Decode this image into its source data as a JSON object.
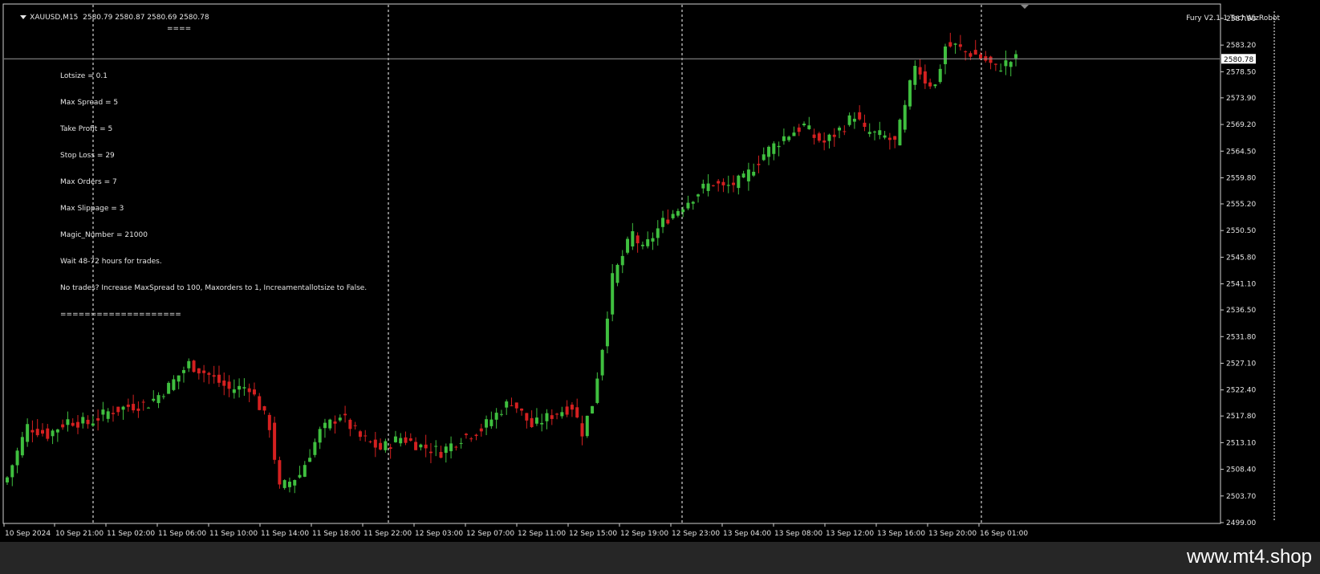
{
  "header": {
    "symbol": "XAUUSD,M15",
    "quote": "2580.79 2580.87 2580.69 2580.78"
  },
  "ea_label": "Fury V2.1-1 TechWizRobot",
  "info_panel": {
    "top_separator": "====",
    "lines": [
      "Lotsize = 0.1",
      "Max Spread = 5",
      "Take Profit = 5",
      "Stop Loss = 29",
      "Max Orders = 7",
      "Max Slippage = 3",
      "Magic_Number = 21000",
      "Wait 48-72 hours for trades.",
      "No trades? Increase MaxSpread to 100, Maxorders to 1, Increamentallotsize to False.",
      "===================="
    ]
  },
  "watermark": "www.mt4.shop",
  "colors": {
    "background": "#000000",
    "bull_candle": "#3fbf3f",
    "bear_candle": "#d42020",
    "grid_line": "#ffffff",
    "text": "#e6e6e6",
    "price_tag_bg": "#ffffff"
  },
  "chart_data": {
    "type": "candlestick",
    "symbol": "XAUUSD",
    "timeframe": "M15",
    "y_ticks": [
      2587.9,
      2583.2,
      2578.5,
      2573.9,
      2569.2,
      2564.5,
      2559.8,
      2555.2,
      2550.5,
      2545.8,
      2541.1,
      2536.5,
      2531.8,
      2527.1,
      2522.4,
      2517.8,
      2513.1,
      2508.4,
      2503.7,
      2499.0
    ],
    "ylim": [
      2499.0,
      2590.3
    ],
    "x_ticks": [
      "10 Sep 2024",
      "10 Sep 21:00",
      "11 Sep 02:00",
      "11 Sep 06:00",
      "11 Sep 10:00",
      "11 Sep 14:00",
      "11 Sep 18:00",
      "11 Sep 22:00",
      "12 Sep 03:00",
      "12 Sep 07:00",
      "12 Sep 11:00",
      "12 Sep 15:00",
      "12 Sep 19:00",
      "12 Sep 23:00",
      "13 Sep 04:00",
      "13 Sep 08:00",
      "13 Sep 12:00",
      "13 Sep 16:00",
      "13 Sep 20:00",
      "16 Sep 01:00"
    ],
    "current_price": 2580.78,
    "period_separators": [
      "10 Sep 21:00",
      "11 Sep 22:00",
      "12 Sep 23:00",
      "16 Sep 00:00"
    ],
    "close_path": [
      [
        0,
        2507
      ],
      [
        4,
        2516
      ],
      [
        8,
        2514.5
      ],
      [
        12,
        2517
      ],
      [
        16,
        2516.5
      ],
      [
        20,
        2518.5
      ],
      [
        24,
        2519.5
      ],
      [
        28,
        2520
      ],
      [
        32,
        2523
      ],
      [
        36,
        2527
      ],
      [
        40,
        2525
      ],
      [
        44,
        2522.5
      ],
      [
        48,
        2523
      ],
      [
        52,
        2516
      ],
      [
        54,
        2505
      ],
      [
        58,
        2507.5
      ],
      [
        62,
        2515
      ],
      [
        66,
        2518
      ],
      [
        70,
        2514
      ],
      [
        74,
        2512
      ],
      [
        78,
        2514
      ],
      [
        82,
        2512.5
      ],
      [
        86,
        2511.5
      ],
      [
        90,
        2514
      ],
      [
        94,
        2515.5
      ],
      [
        98,
        2519
      ],
      [
        100,
        2520.5
      ],
      [
        104,
        2516
      ],
      [
        108,
        2518
      ],
      [
        112,
        2519.5
      ],
      [
        114,
        2515
      ],
      [
        116,
        2520
      ],
      [
        118,
        2530
      ],
      [
        120,
        2542
      ],
      [
        124,
        2550
      ],
      [
        126,
        2547
      ],
      [
        130,
        2552
      ],
      [
        134,
        2555
      ],
      [
        138,
        2558
      ],
      [
        140,
        2559
      ],
      [
        142,
        2558
      ],
      [
        146,
        2559.5
      ],
      [
        150,
        2564
      ],
      [
        154,
        2567
      ],
      [
        158,
        2569
      ],
      [
        160,
        2567
      ],
      [
        162,
        2566
      ],
      [
        166,
        2569
      ],
      [
        168,
        2571
      ],
      [
        170,
        2568
      ],
      [
        174,
        2567
      ],
      [
        176,
        2566
      ],
      [
        178,
        2572
      ],
      [
        180,
        2580
      ],
      [
        182,
        2577
      ],
      [
        184,
        2576
      ],
      [
        186,
        2583
      ],
      [
        188,
        2583
      ],
      [
        190,
        2582
      ],
      [
        192,
        2581.5
      ],
      [
        194,
        2580.5
      ],
      [
        196,
        2579
      ],
      [
        198,
        2580
      ],
      [
        200,
        2580.78
      ]
    ]
  }
}
